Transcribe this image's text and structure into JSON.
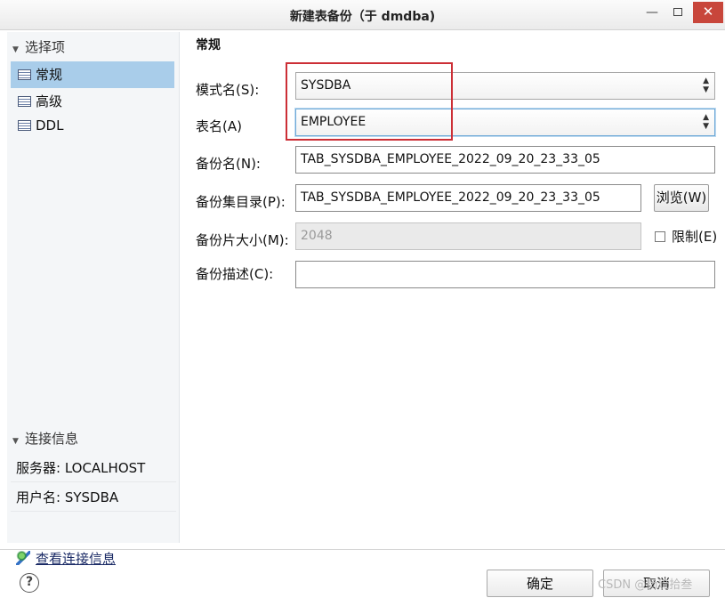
{
  "window": {
    "title": "新建表备份（于 dmdba)",
    "minimize_glyph": "—",
    "close_glyph": "✕"
  },
  "sidebar": {
    "section_title": "选择项",
    "items": [
      {
        "label": "常规",
        "active": true
      },
      {
        "label": "高级",
        "active": false
      },
      {
        "label": "DDL",
        "active": false
      }
    ]
  },
  "connection": {
    "section_title": "连接信息",
    "server": "服务器: LOCALHOST",
    "user": "用户名: SYSDBA",
    "view_link": "查看连接信息"
  },
  "form": {
    "group_title": "常规",
    "schema_label": "模式名(S):",
    "schema_value": "SYSDBA",
    "table_label": "表名(A)",
    "table_value": "EMPLOYEE",
    "backup_name_label": "备份名(N):",
    "backup_name_value": "TAB_SYSDBA_EMPLOYEE_2022_09_20_23_33_05",
    "backup_dir_label": "备份集目录(P):",
    "backup_dir_value": "TAB_SYSDBA_EMPLOYEE_2022_09_20_23_33_05",
    "browse_label": "浏览(W)",
    "piece_size_label": "备份片大小(M):",
    "piece_size_placeholder": "2048",
    "limit_label": "限制(E)",
    "limit_checked": false,
    "description_label": "备份描述(C):",
    "description_value": ""
  },
  "footer": {
    "help_glyph": "?",
    "ok_label": "确定",
    "cancel_label": "取消",
    "watermark": "CSDN @杨琉拾叁"
  },
  "colors": {
    "active_nav": "#a9cdea",
    "annotation_box": "#cc2f36",
    "close_button": "#c8463b"
  }
}
